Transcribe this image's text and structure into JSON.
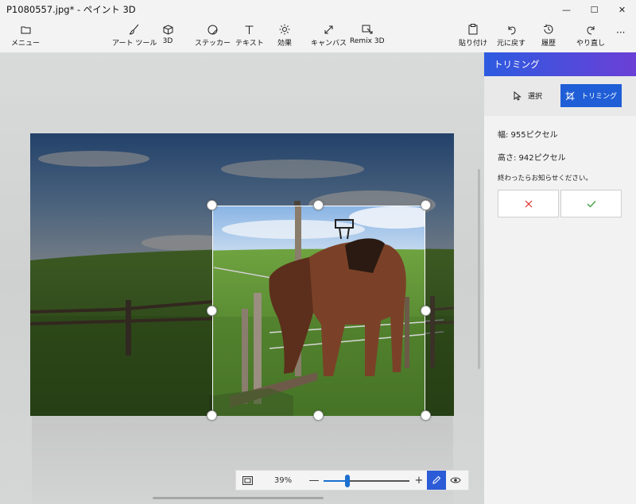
{
  "window": {
    "title": "P1080557.jpg* - ペイント 3D",
    "minimize": "—",
    "maximize": "☐",
    "close": "✕"
  },
  "toolbar": {
    "menu_label": "メニュー",
    "art_tools_label": "アート ツール",
    "threed_label": "3D",
    "stickers_label": "ステッカー",
    "text_label": "テキスト",
    "effects_label": "効果",
    "canvas_label": "キャンバス",
    "remix_label": "Remix 3D",
    "paste_label": "貼り付け",
    "undo_label": "元に戻す",
    "history_label": "履歴",
    "redo_label": "やり直し",
    "more_label": "···"
  },
  "zoom": {
    "percent_label": "39%",
    "minus": "—",
    "plus": "+",
    "level_fraction": 0.28
  },
  "panel": {
    "title": "トリミング",
    "tab_select_label": "選択",
    "tab_trim_label": "トリミング",
    "width_label": "幅: 955ピクセル",
    "height_label": "高さ: 942ピクセル",
    "hint": "終わったらお知らせください。"
  },
  "colors": {
    "accent": "#1f5ed6",
    "cancel": "#d9312b",
    "confirm": "#3a9a3a"
  }
}
